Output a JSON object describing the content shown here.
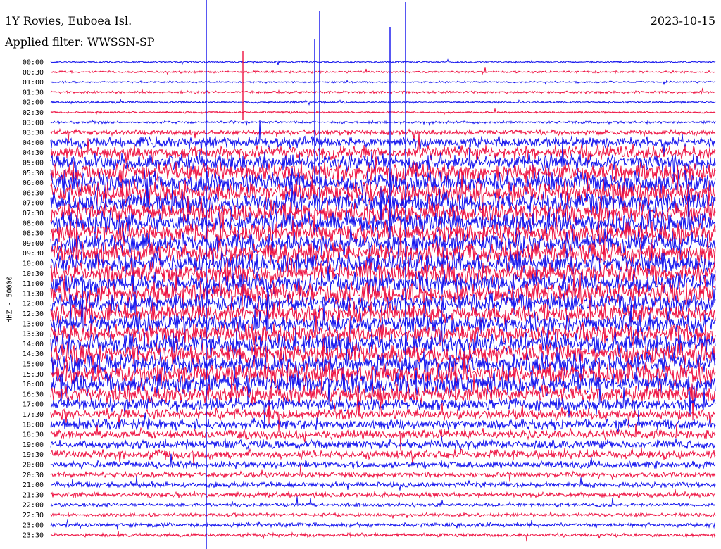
{
  "header": {
    "station": "1Y Rovies, Euboea Isl.",
    "date": "2023-10-15",
    "filter": "Applied filter: WWSSN-SP"
  },
  "chart_data": {
    "type": "line",
    "subtype": "helicorder",
    "channel_label": "HHZ - 50000",
    "row_labels": [
      "00:00",
      "00:30",
      "01:00",
      "01:30",
      "02:00",
      "02:30",
      "03:00",
      "03:30",
      "04:00",
      "04:30",
      "05:00",
      "05:30",
      "06:00",
      "06:30",
      "07:00",
      "07:30",
      "08:00",
      "08:30",
      "09:00",
      "09:30",
      "10:00",
      "10:30",
      "11:00",
      "11:30",
      "12:00",
      "12:30",
      "13:00",
      "13:30",
      "14:00",
      "14:30",
      "15:00",
      "15:30",
      "16:00",
      "16:30",
      "17:00",
      "17:30",
      "18:00",
      "18:30",
      "19:00",
      "19:30",
      "20:00",
      "20:30",
      "21:00",
      "21:30",
      "22:00",
      "22:30",
      "23:00",
      "23:30"
    ],
    "row_amplitude": [
      1,
      1.2,
      1,
      1.4,
      1.3,
      1.1,
      1.4,
      3,
      6,
      8,
      9,
      11,
      12,
      12,
      12,
      12,
      12,
      12,
      12,
      12,
      12,
      12,
      12,
      12,
      11,
      11,
      11,
      11,
      12,
      12,
      12,
      12,
      12,
      10,
      7,
      6,
      6,
      5,
      5,
      5,
      4,
      3,
      3,
      3,
      2,
      2,
      2.5,
      2
    ],
    "colors": {
      "even": "#1010ee",
      "odd": "#ee1040"
    },
    "grid": false,
    "legend": "none"
  }
}
